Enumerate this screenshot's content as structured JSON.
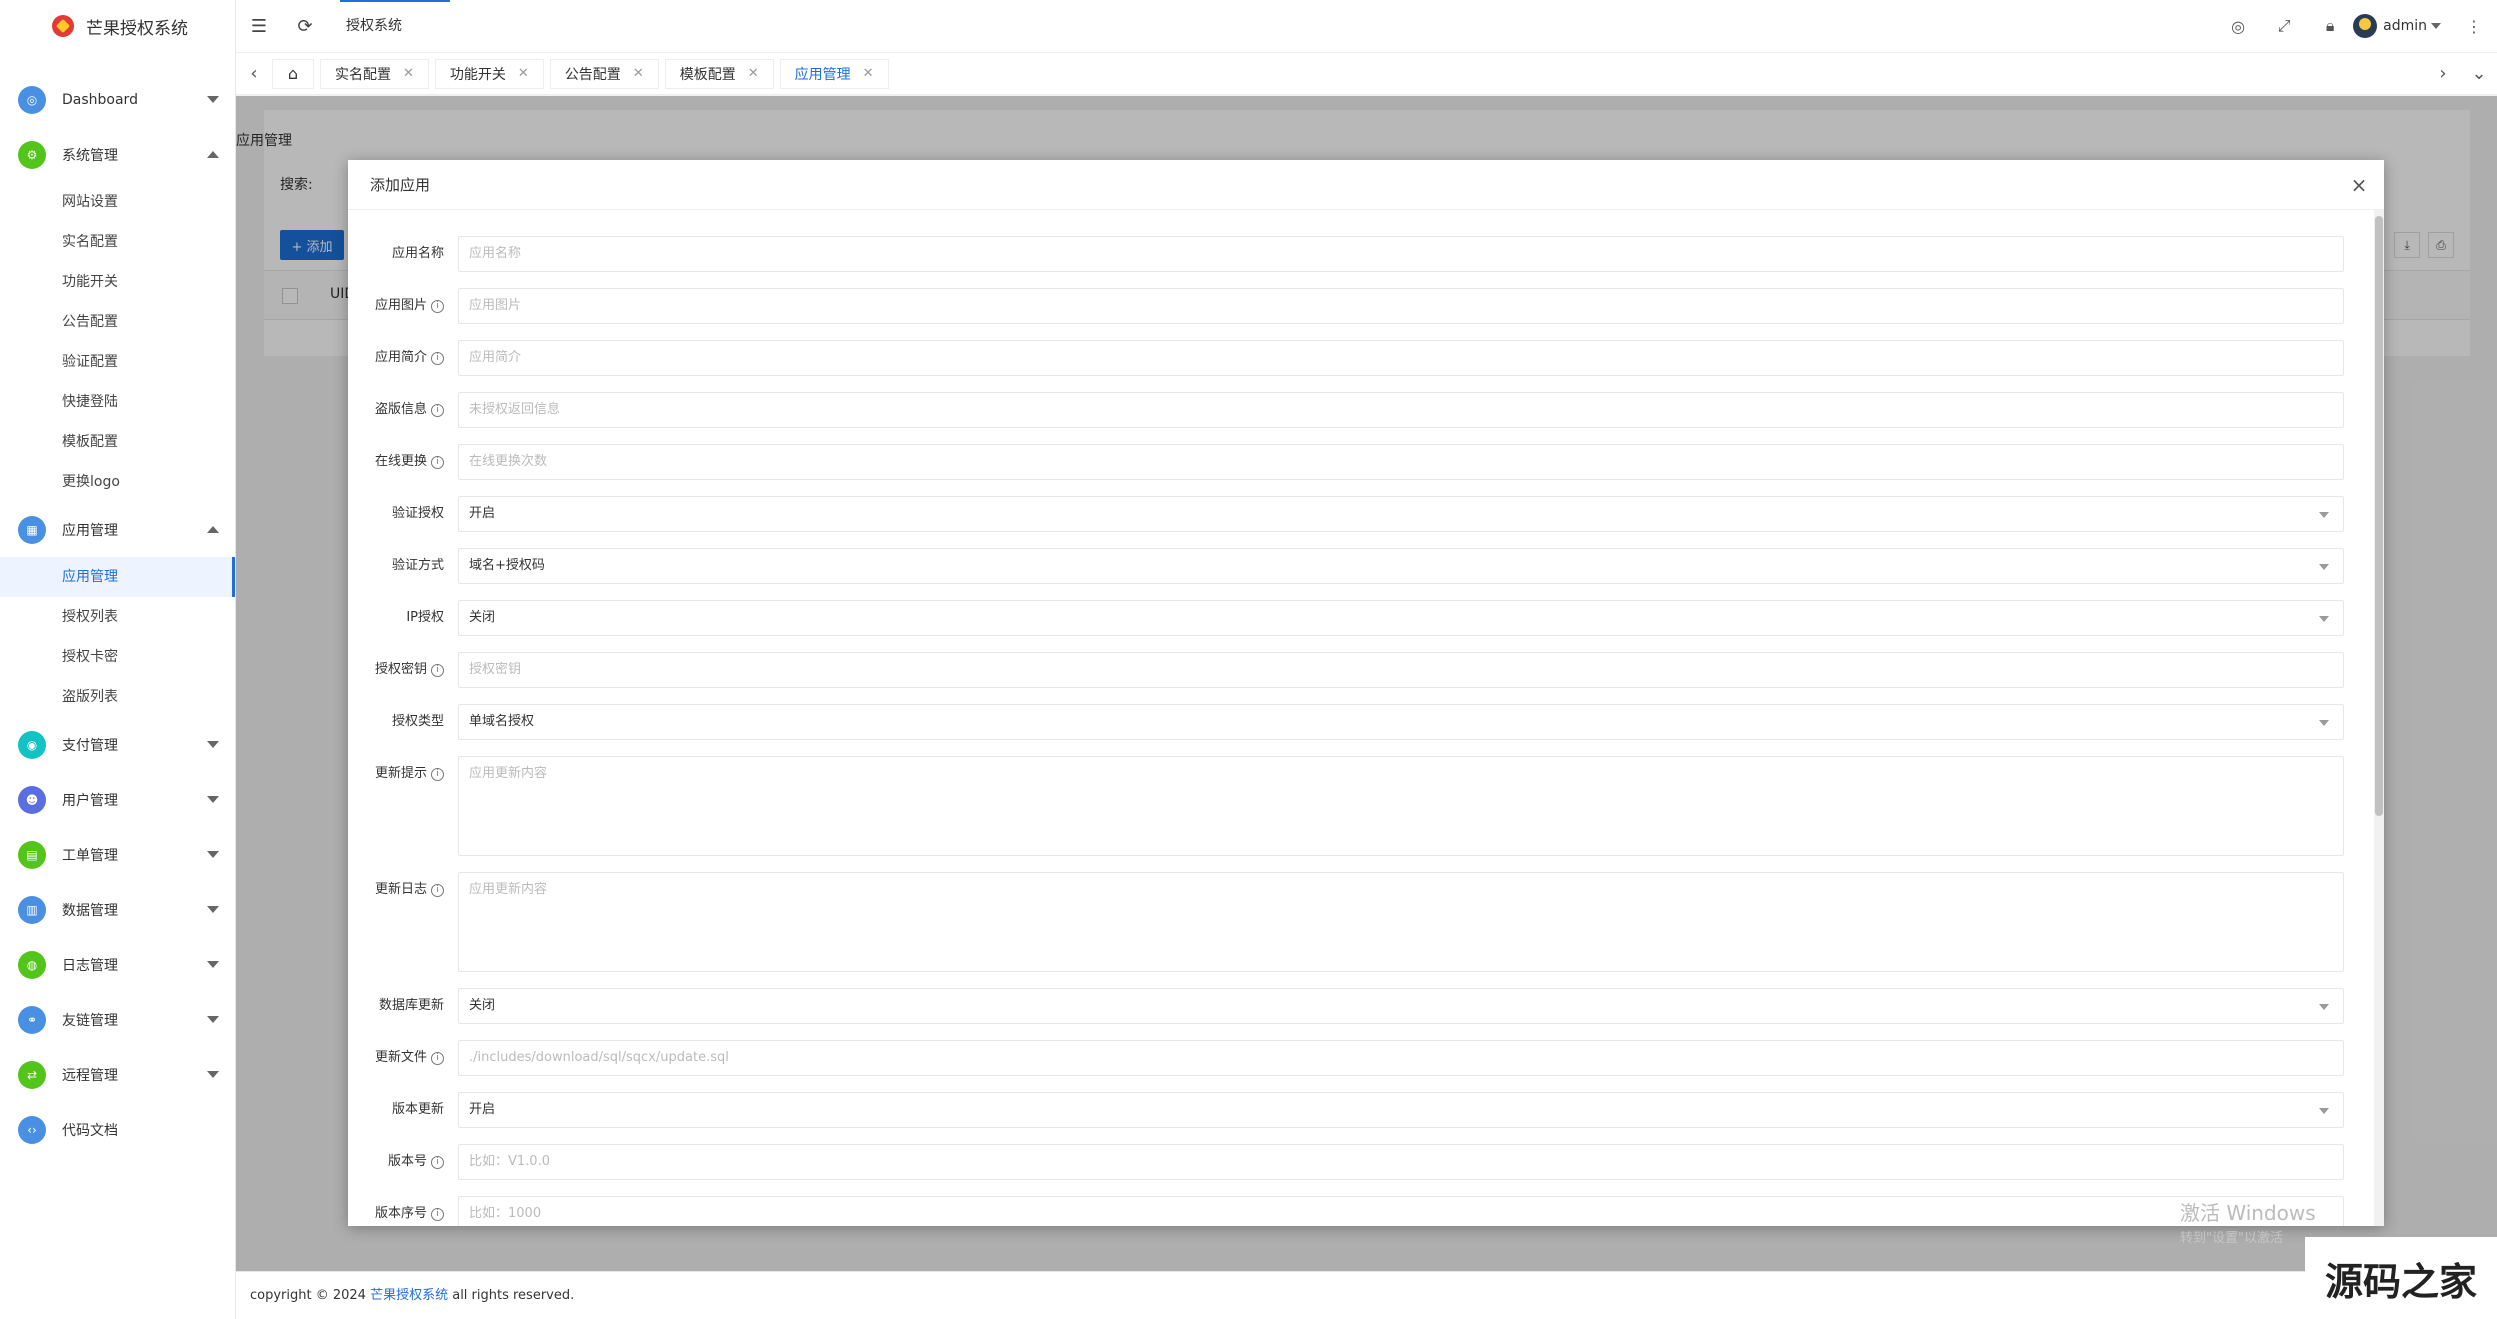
{
  "app": {
    "title": "芒果授权系统"
  },
  "sidebar": {
    "groups": [
      {
        "label": "Dashboard",
        "icon": "dashboard-icon",
        "color": "#4a90e2"
      },
      {
        "label": "系统管理",
        "icon": "gear-icon",
        "color": "#52c41a",
        "children": [
          "网站设置",
          "实名配置",
          "功能开关",
          "公告配置",
          "验证配置",
          "快捷登陆",
          "模板配置",
          "更换logo"
        ]
      },
      {
        "label": "应用管理",
        "icon": "app-icon",
        "color": "#4a90e2",
        "children": [
          "应用管理",
          "授权列表",
          "授权卡密",
          "盗版列表"
        ],
        "active_child": "应用管理"
      },
      {
        "label": "支付管理",
        "icon": "pay-icon",
        "color": "#13c2c2"
      },
      {
        "label": "用户管理",
        "icon": "user-icon",
        "color": "#5b6ee1"
      },
      {
        "label": "工单管理",
        "icon": "ticket-icon",
        "color": "#52c41a"
      },
      {
        "label": "数据管理",
        "icon": "data-icon",
        "color": "#4a90e2"
      },
      {
        "label": "日志管理",
        "icon": "log-icon",
        "color": "#52c41a"
      },
      {
        "label": "友链管理",
        "icon": "link-icon",
        "color": "#4a90e2"
      },
      {
        "label": "远程管理",
        "icon": "share-icon",
        "color": "#52c41a"
      },
      {
        "label": "代码文档",
        "icon": "code-icon",
        "color": "#4a90e2"
      }
    ]
  },
  "topbar": {
    "crumb": "授权系统",
    "user": "admin"
  },
  "tabs": [
    {
      "label": "实名配置"
    },
    {
      "label": "功能开关"
    },
    {
      "label": "公告配置"
    },
    {
      "label": "模板配置"
    },
    {
      "label": "应用管理",
      "active": true
    }
  ],
  "page": {
    "title": "应用管理",
    "search_label": "搜索:",
    "add_label": "+ 添加",
    "column_uid": "UID"
  },
  "modal": {
    "title": "添加应用",
    "fields": [
      {
        "label": "应用名称",
        "info": false,
        "type": "input",
        "placeholder": "应用名称"
      },
      {
        "label": "应用图片",
        "info": true,
        "type": "input",
        "placeholder": "应用图片"
      },
      {
        "label": "应用简介",
        "info": true,
        "type": "input",
        "placeholder": "应用简介"
      },
      {
        "label": "盗版信息",
        "info": true,
        "type": "input",
        "placeholder": "未授权返回信息"
      },
      {
        "label": "在线更换",
        "info": true,
        "type": "input",
        "placeholder": "在线更换次数"
      },
      {
        "label": "验证授权",
        "info": false,
        "type": "select",
        "value": "开启"
      },
      {
        "label": "验证方式",
        "info": false,
        "type": "select",
        "value": "域名+授权码"
      },
      {
        "label": "IP授权",
        "info": false,
        "type": "select",
        "value": "关闭"
      },
      {
        "label": "授权密钥",
        "info": true,
        "type": "input",
        "placeholder": "授权密钥"
      },
      {
        "label": "授权类型",
        "info": false,
        "type": "select",
        "value": "单域名授权"
      },
      {
        "label": "更新提示",
        "info": true,
        "type": "textarea",
        "placeholder": "应用更新内容"
      },
      {
        "label": "更新日志",
        "info": true,
        "type": "textarea",
        "placeholder": "应用更新内容"
      },
      {
        "label": "数据库更新",
        "info": false,
        "type": "select",
        "value": "关闭"
      },
      {
        "label": "更新文件",
        "info": true,
        "type": "input",
        "placeholder": "./includes/download/sql/sqcx/update.sql"
      },
      {
        "label": "版本更新",
        "info": false,
        "type": "select",
        "value": "开启"
      },
      {
        "label": "版本号",
        "info": true,
        "type": "input",
        "placeholder": "比如：V1.0.0"
      },
      {
        "label": "版本序号",
        "info": true,
        "type": "input",
        "placeholder": "比如：1000"
      }
    ]
  },
  "footer": {
    "prefix": "copyright © 2024 ",
    "link": "芒果授权系统",
    "suffix": " all rights reserved."
  },
  "overlay_text": {
    "windows": "激活 Windows",
    "windows_sub": "转到\"设置\"以激活",
    "brand": "源码之家"
  }
}
